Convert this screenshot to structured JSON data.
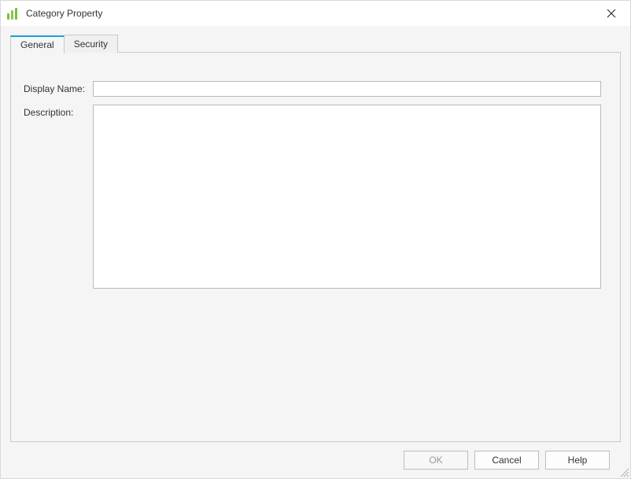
{
  "window": {
    "title": "Category Property"
  },
  "tabs": {
    "general": "General",
    "security": "Security"
  },
  "form": {
    "displayName": {
      "label": "Display Name:",
      "value": ""
    },
    "description": {
      "label": "Description:",
      "value": ""
    }
  },
  "buttons": {
    "ok": "OK",
    "cancel": "Cancel",
    "help": "Help"
  }
}
